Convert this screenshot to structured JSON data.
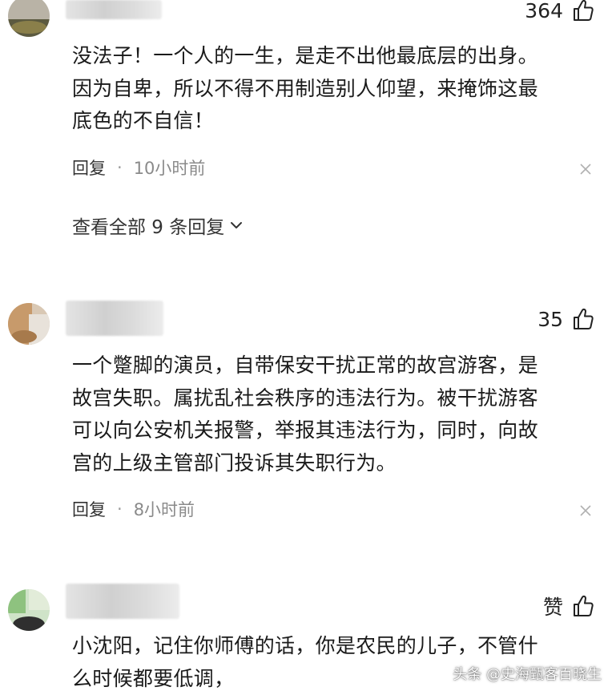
{
  "comments": [
    {
      "likes": "364",
      "text_lines": [
        "没法子！一个人的一生，是走不出他最底层的出身。",
        "因为自卑，所以不得不用制造别人仰望，来掩饰这最",
        "底色的不自信！"
      ],
      "reply_label": "回复",
      "separator": "·",
      "time": "10小时前",
      "view_all": "查看全部 9 条回复"
    },
    {
      "likes": "35",
      "text_lines": [
        "一个蹩脚的演员，自带保安干扰正常的故宫游客，是",
        "故宫失职。属扰乱社会秩序的违法行为。被干扰游客",
        "可以向公安机关报警，举报其违法行为，同时，向故",
        "宫的上级主管部门投诉其失职行为。"
      ],
      "reply_label": "回复",
      "separator": "·",
      "time": "8小时前"
    },
    {
      "likes": "赞",
      "text_lines": [
        "小沈阳，记住你师傅的话，你是农民的儿子，不管什",
        "么时候都要低调，"
      ]
    }
  ],
  "watermark": "头条 @史海甄客百晓生",
  "icons": {
    "like": "thumbs-up-icon",
    "close": "close-icon",
    "chevron": "chevron-down-icon"
  },
  "colors": {
    "text": "#1a1a1a",
    "meta": "#8a8a8a",
    "background": "#ffffff"
  }
}
